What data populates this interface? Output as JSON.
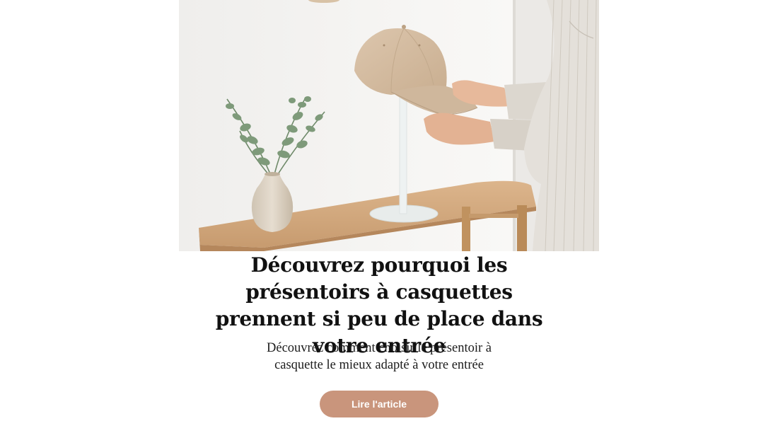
{
  "article": {
    "title": "Découvrez pourquoi les présentoirs à casquettes prennent si peu de place dans votre entrée",
    "subtitle": "Découvrez comment choisir le présentoir à casquette le mieux adapté à votre entrée",
    "cta_label": "Lire l'article"
  },
  "colors": {
    "button_bg": "#c9957c",
    "button_text": "#ffffff",
    "title_text": "#111111"
  }
}
